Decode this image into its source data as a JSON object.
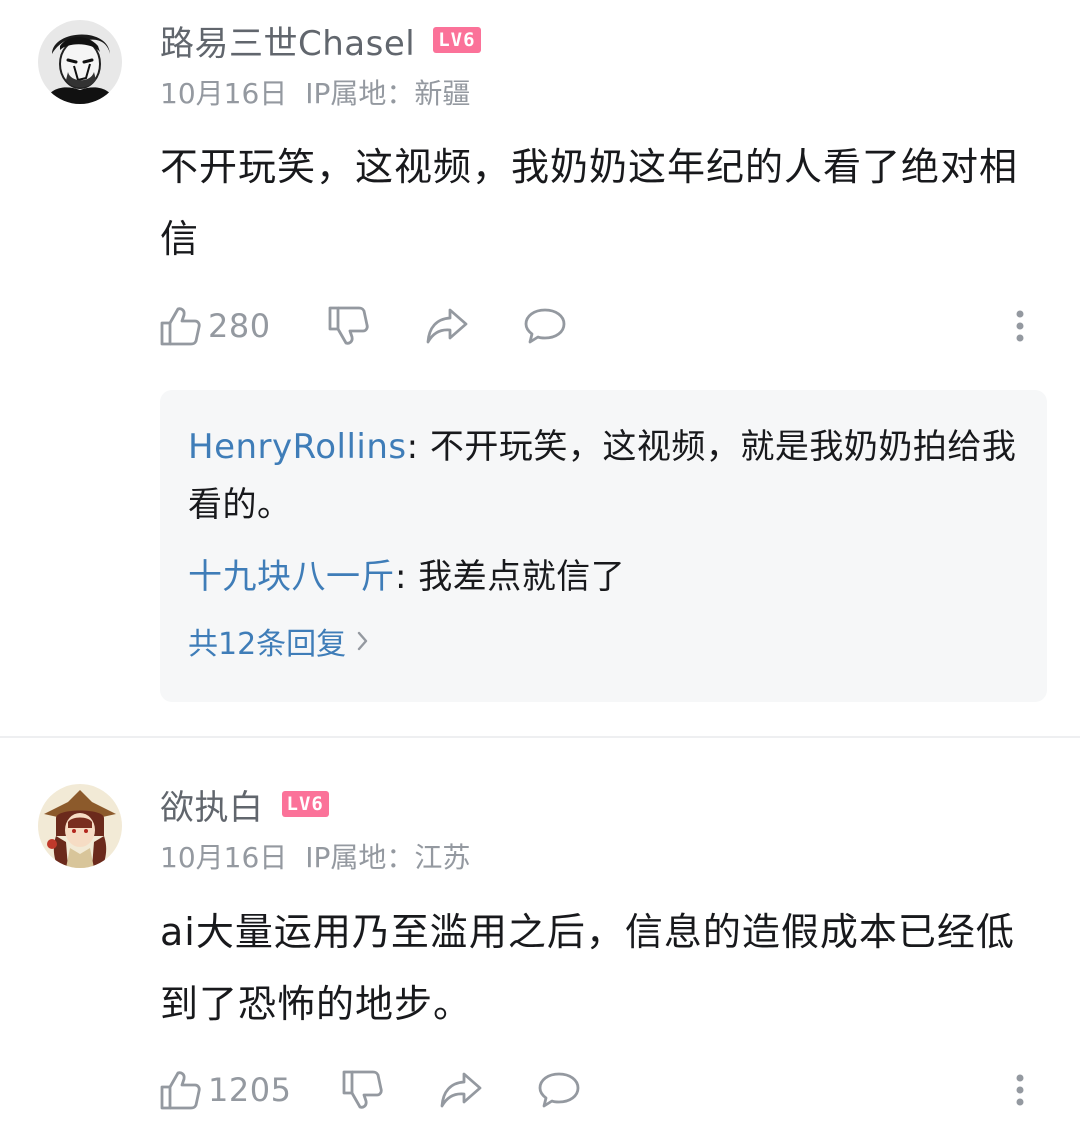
{
  "comments": [
    {
      "username": "路易三世Chasel",
      "level": "LV6",
      "date": "10月16日",
      "ip_location": "IP属地：新疆",
      "content": "不开玩笑，这视频，我奶奶这年纪的人看了绝对相信",
      "likes": "280",
      "replies": [
        {
          "name": "HenryRollins",
          "separator": ": ",
          "text": "不开玩笑，这视频，就是我奶奶拍给我看的。"
        },
        {
          "name": "十九块八一斤",
          "separator": ": ",
          "text": "我差点就信了"
        }
      ],
      "view_all_replies": "共12条回复"
    },
    {
      "username": "欲执白",
      "level": "LV6",
      "date": "10月16日",
      "ip_location": "IP属地：江苏",
      "content": "ai大量运用乃至滥用之后，信息的造假成本已经低到了恐怖的地步。",
      "likes": "1205"
    }
  ],
  "icons": {
    "like": "thumbs-up-icon",
    "dislike": "thumbs-down-icon",
    "share": "share-icon",
    "reply": "comment-bubble-icon",
    "more": "more-vertical-icon",
    "chevron": "chevron-right-icon"
  },
  "colors": {
    "username": "#61666d",
    "meta": "#9499a0",
    "level_badge": "#fb7299",
    "reply_link": "#3f7db8",
    "reply_background": "#f6f7f8"
  }
}
